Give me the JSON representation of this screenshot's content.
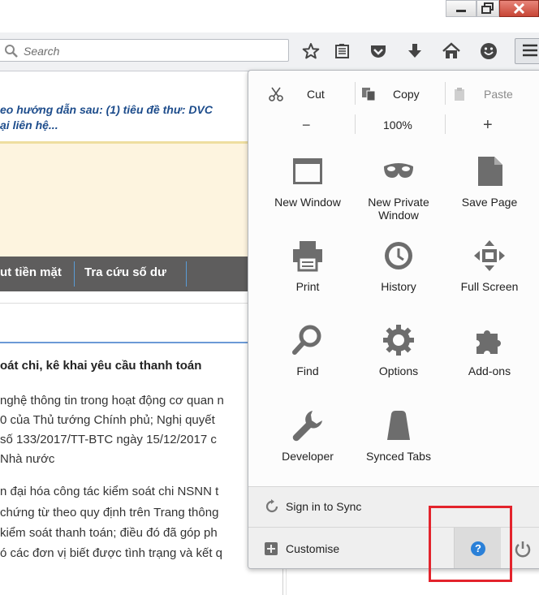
{
  "search": {
    "placeholder": "Search"
  },
  "page": {
    "notice_line1": "eo hướng dẫn sau: (1) tiêu đề thư: DVC",
    "notice_line2": "ại liên hệ...",
    "nav_links": [
      "ut tiền mặt",
      "Tra cứu số dư"
    ],
    "heading": "oát chi, kê khai yêu cầu thanh toán",
    "paragraph1": [
      "nghệ thông tin trong hoạt động cơ quan n",
      "0 của Thủ tướng Chính phủ; Nghị quyết",
      "số 133/2017/TT-BTC ngày 15/12/2017 c",
      "Nhà nước"
    ],
    "paragraph2": [
      "n đại hóa công tác kiểm soát chi NSNN t",
      "chứng từ theo quy định trên Trang thông",
      "kiểm soát thanh toán; điều đó đã góp ph",
      "ó các đơn vị biết được tình trạng và kết q"
    ]
  },
  "menu": {
    "edit": {
      "cut": "Cut",
      "copy": "Copy",
      "paste": "Paste"
    },
    "zoom": {
      "out": "−",
      "level": "100%",
      "in": "+"
    },
    "items": [
      {
        "label": "New Window",
        "icon": "new-window-icon"
      },
      {
        "label": "New Private Window",
        "icon": "private-mask-icon"
      },
      {
        "label": "Save Page",
        "icon": "save-page-icon"
      },
      {
        "label": "Print",
        "icon": "printer-icon"
      },
      {
        "label": "History",
        "icon": "clock-icon"
      },
      {
        "label": "Full Screen",
        "icon": "fullscreen-arrows-icon"
      },
      {
        "label": "Find",
        "icon": "magnifier-icon"
      },
      {
        "label": "Options",
        "icon": "gear-icon"
      },
      {
        "label": "Add-ons",
        "icon": "puzzle-icon"
      },
      {
        "label": "Developer",
        "icon": "wrench-icon"
      },
      {
        "label": "Synced Tabs",
        "icon": "synced-tabs-icon"
      }
    ],
    "sign_in": "Sign in to Sync",
    "customise": "Customise",
    "help_symbol": "?"
  },
  "colors": {
    "accent": "#1e4d8c",
    "highlight_box": "#e3232c",
    "help_blue": "#2a80d8"
  }
}
